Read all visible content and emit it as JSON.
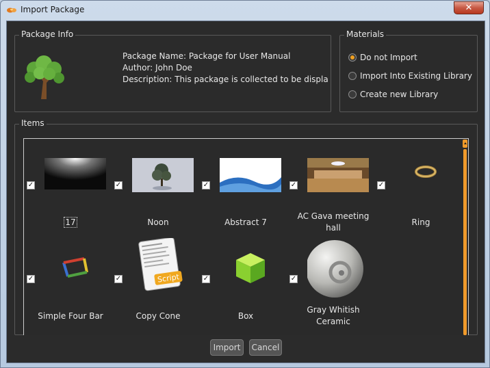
{
  "window": {
    "title": "Import Package",
    "close_glyph": "✕"
  },
  "package_info": {
    "group_title": "Package Info",
    "name_line": "Package Name: Package for User Manual",
    "author_line": "Author: John Doe",
    "description_line": "Description: This package is collected to be display"
  },
  "materials": {
    "group_title": "Materials",
    "options": [
      {
        "label": "Do not Import",
        "selected": true
      },
      {
        "label": "Import Into Existing Library",
        "selected": false
      },
      {
        "label": "Create new Library",
        "selected": false
      }
    ]
  },
  "items": {
    "group_title": "Items",
    "list": [
      {
        "name": "17",
        "thumb": "light-gradient",
        "checked": true
      },
      {
        "name": "Noon",
        "thumb": "tree-photo",
        "checked": true
      },
      {
        "name": "Abstract 7",
        "thumb": "blue-wave",
        "checked": true
      },
      {
        "name": "AC Gava meeting hall",
        "thumb": "meeting-hall",
        "checked": true
      },
      {
        "name": "Ring",
        "thumb": "ring",
        "checked": true
      },
      {
        "name": "Simple Four Bar",
        "thumb": "four-bar",
        "checked": true
      },
      {
        "name": "Copy Cone",
        "thumb": "script-doc",
        "checked": true
      },
      {
        "name": "Box",
        "thumb": "green-box",
        "checked": true
      },
      {
        "name": "Gray Whitish Ceramic",
        "thumb": "ceramic-sphere",
        "checked": true
      }
    ]
  },
  "buttons": {
    "import": "Import",
    "cancel": "Cancel"
  },
  "colors": {
    "accent": "#f09a2a",
    "panel": "#2b2b2b"
  }
}
